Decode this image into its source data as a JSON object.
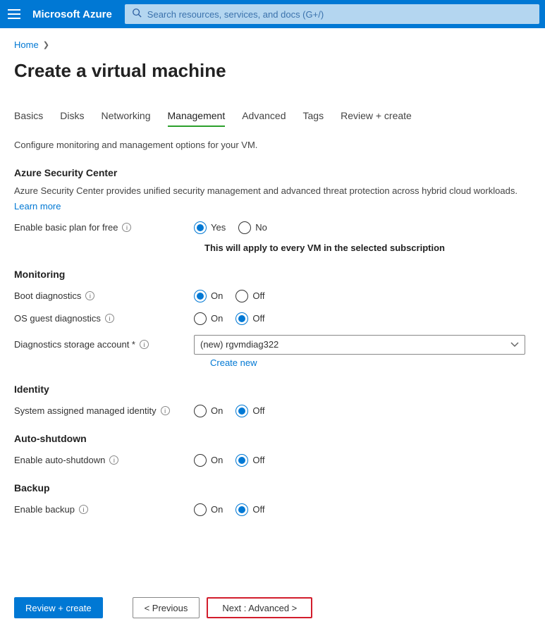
{
  "topbar": {
    "brand": "Microsoft Azure",
    "search_placeholder": "Search resources, services, and docs (G+/)"
  },
  "breadcrumb": {
    "home": "Home"
  },
  "page_title": "Create a virtual machine",
  "tabs": {
    "basics": "Basics",
    "disks": "Disks",
    "networking": "Networking",
    "management": "Management",
    "advanced": "Advanced",
    "tags": "Tags",
    "review": "Review + create"
  },
  "description": "Configure monitoring and management options for your VM.",
  "security": {
    "title": "Azure Security Center",
    "desc": "Azure Security Center provides unified security management and advanced threat protection across hybrid cloud workloads.",
    "learn": "Learn more",
    "enable_label": "Enable basic plan for free",
    "yes": "Yes",
    "no": "No",
    "note": "This will apply to every VM in the selected subscription"
  },
  "monitoring": {
    "title": "Monitoring",
    "boot": "Boot diagnostics",
    "os": "OS guest diagnostics",
    "storage": "Diagnostics storage account *",
    "storage_value": "(new) rgvmdiag322",
    "create_new": "Create new"
  },
  "identity": {
    "title": "Identity",
    "label": "System assigned managed identity"
  },
  "autoshutdown": {
    "title": "Auto-shutdown",
    "label": "Enable auto-shutdown"
  },
  "backup": {
    "title": "Backup",
    "label": "Enable backup"
  },
  "radio": {
    "on": "On",
    "off": "Off"
  },
  "footer": {
    "review": "Review + create",
    "previous": "< Previous",
    "next": "Next : Advanced >"
  }
}
